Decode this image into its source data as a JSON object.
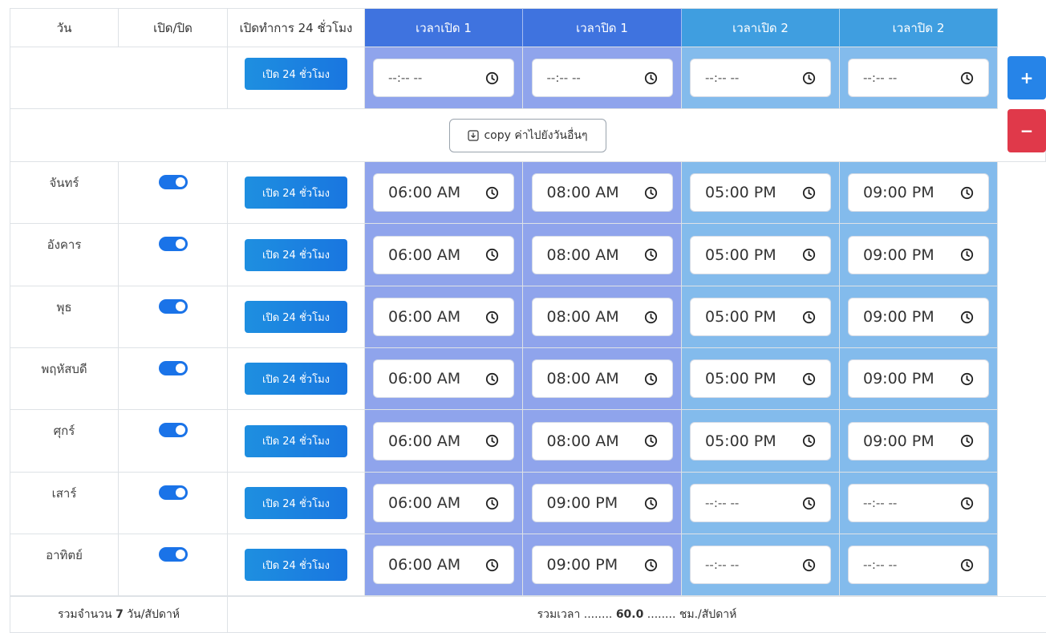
{
  "header": {
    "day": "วัน",
    "onoff": "เปิด/ปิด",
    "open24": "เปิดทำการ 24 ชั่วโมง",
    "open1": "เวลาเปิด 1",
    "close1": "เวลาปิด 1",
    "open2": "เวลาเปิด 2",
    "close2": "เวลาปิด 2"
  },
  "template_row": {
    "button": "เปิด 24 ชั่วโมง",
    "open1": "--:-- --",
    "close1": "--:-- --",
    "open2": "--:-- --",
    "close2": "--:-- --"
  },
  "copy_button": "copy ค่าไปยังวันอื่นๆ",
  "days": [
    {
      "name": "จันทร์",
      "button": "เปิด 24 ชั่วโมง",
      "enabled": true,
      "open1": "06:00 AM",
      "close1": "08:00 AM",
      "open2": "05:00 PM",
      "close2": "09:00 PM"
    },
    {
      "name": "อังคาร",
      "button": "เปิด 24 ชั่วโมง",
      "enabled": true,
      "open1": "06:00 AM",
      "close1": "08:00 AM",
      "open2": "05:00 PM",
      "close2": "09:00 PM"
    },
    {
      "name": "พุธ",
      "button": "เปิด 24 ชั่วโมง",
      "enabled": true,
      "open1": "06:00 AM",
      "close1": "08:00 AM",
      "open2": "05:00 PM",
      "close2": "09:00 PM"
    },
    {
      "name": "พฤหัสบดี",
      "button": "เปิด 24 ชั่วโมง",
      "enabled": true,
      "open1": "06:00 AM",
      "close1": "08:00 AM",
      "open2": "05:00 PM",
      "close2": "09:00 PM"
    },
    {
      "name": "ศุกร์",
      "button": "เปิด 24 ชั่วโมง",
      "enabled": true,
      "open1": "06:00 AM",
      "close1": "08:00 AM",
      "open2": "05:00 PM",
      "close2": "09:00 PM"
    },
    {
      "name": "เสาร์",
      "button": "เปิด 24 ชั่วโมง",
      "enabled": true,
      "open1": "06:00 AM",
      "close1": "09:00 PM",
      "open2": "--:-- --",
      "close2": "--:-- --"
    },
    {
      "name": "อาทิตย์",
      "button": "เปิด 24 ชั่วโมง",
      "enabled": true,
      "open1": "06:00 AM",
      "close1": "09:00 PM",
      "open2": "--:-- --",
      "close2": "--:-- --"
    }
  ],
  "footer": {
    "days_prefix": "รวมจำนวน ",
    "days_count": "7",
    "days_suffix": " วัน/สัปดาห์",
    "hours_prefix": "รวมเวลา ........ ",
    "hours_value": "60.0",
    "hours_suffix": " ........ ชม./สัปดาห์"
  },
  "side_buttons": {
    "add": "+",
    "remove": "−"
  },
  "colors": {
    "header_dark": "#3f73df",
    "header_light": "#3f9ee0",
    "column_dark": "#8fa4ec",
    "column_light": "#83bbec",
    "add_button": "#2684e8",
    "remove_button": "#e0394a",
    "toggle": "#1a73e8"
  },
  "icons": {
    "time": "clock-icon",
    "copy": "download-icon"
  }
}
